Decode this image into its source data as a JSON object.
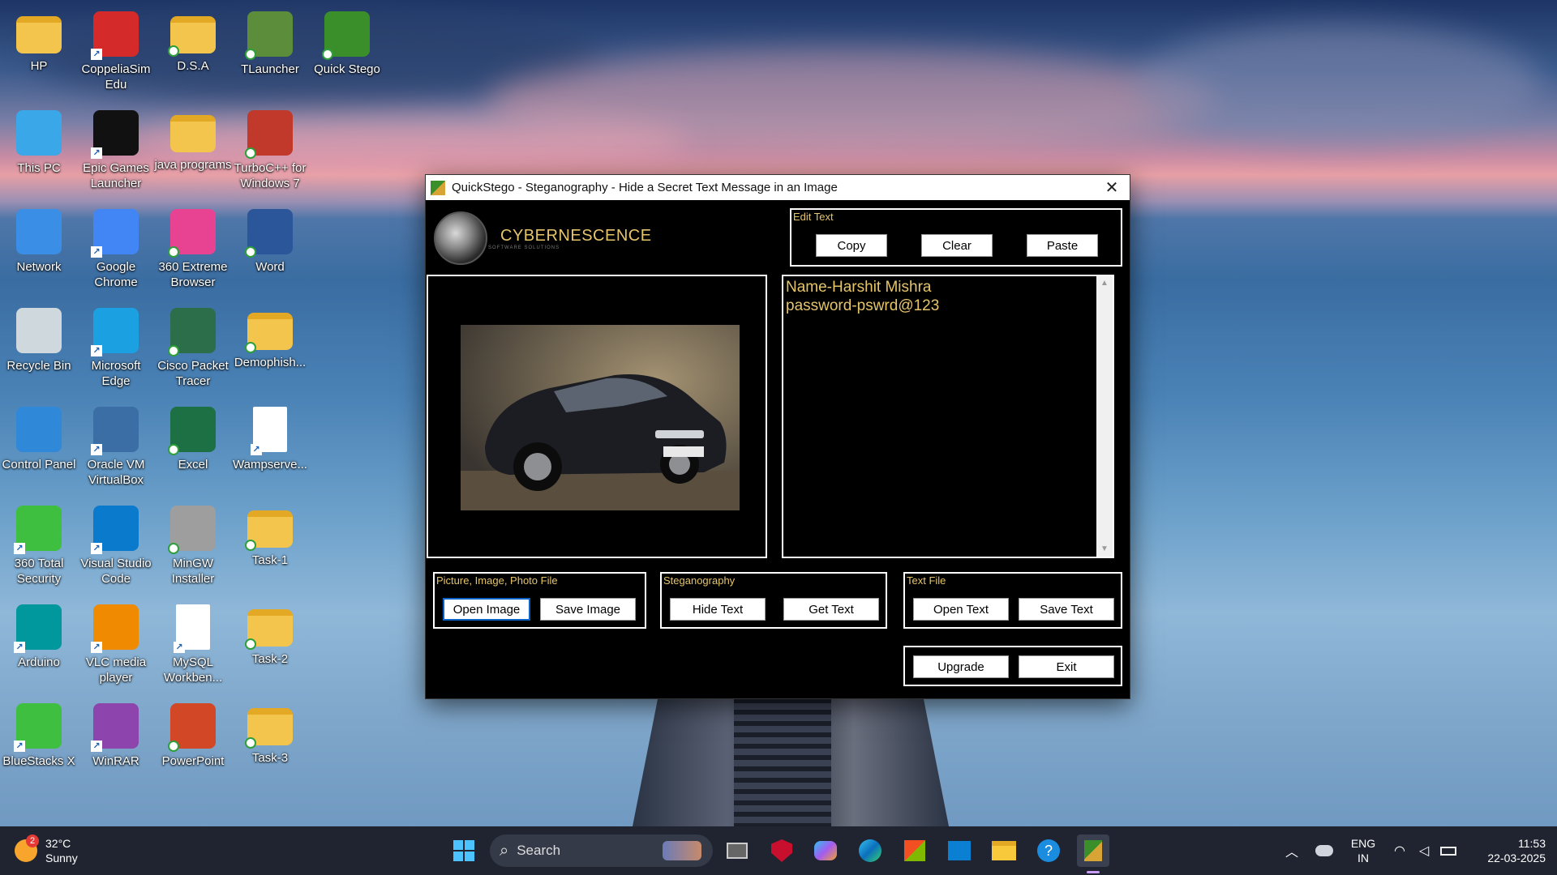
{
  "desktop": {
    "icons": [
      {
        "label": "HP",
        "icon": "folder-user-icon",
        "color": "#f3c54d"
      },
      {
        "label": "CoppeliaSim Edu",
        "icon": "coppeliasim-icon",
        "color": "#d42a2a"
      },
      {
        "label": "D.S.A",
        "icon": "folder-icon",
        "color": "#f3c54d"
      },
      {
        "label": "TLauncher",
        "icon": "minecraft-block-icon",
        "color": "#5b8d3b"
      },
      {
        "label": "Quick Stego",
        "icon": "quickstego-icon",
        "color": "#3b8f2b"
      },
      {
        "label": "This PC",
        "icon": "monitor-icon",
        "color": "#39a7e8"
      },
      {
        "label": "Epic Games Launcher",
        "icon": "epic-games-icon",
        "color": "#111111"
      },
      {
        "label": "java programs",
        "icon": "folder-icon",
        "color": "#f3c54d"
      },
      {
        "label": "TurboC++ for Windows 7",
        "icon": "turboc-icon",
        "color": "#c0392b"
      },
      {
        "label": "Network",
        "icon": "network-icon",
        "color": "#3a8ee6"
      },
      {
        "label": "Google Chrome",
        "icon": "chrome-icon",
        "color": "#4285f4"
      },
      {
        "label": "360 Extreme Browser",
        "icon": "360-browser-icon",
        "color": "#e84393"
      },
      {
        "label": "Word",
        "icon": "word-icon",
        "color": "#2b579a"
      },
      {
        "label": "Recycle Bin",
        "icon": "recycle-bin-icon",
        "color": "#cfd8dc"
      },
      {
        "label": "Microsoft Edge",
        "icon": "edge-icon",
        "color": "#1ba1e2"
      },
      {
        "label": "Cisco Packet Tracer",
        "icon": "cisco-packet-tracer-icon",
        "color": "#2c6e49"
      },
      {
        "label": "Demophish...",
        "icon": "folder-icon",
        "color": "#f3c54d"
      },
      {
        "label": "Control Panel",
        "icon": "control-panel-icon",
        "color": "#2f88d8"
      },
      {
        "label": "Oracle VM VirtualBox",
        "icon": "virtualbox-icon",
        "color": "#3a6ea5"
      },
      {
        "label": "Excel",
        "icon": "excel-icon",
        "color": "#1d7044"
      },
      {
        "label": "Wampserve...",
        "icon": "file-icon",
        "color": "#ffffff"
      },
      {
        "label": "360 Total Security",
        "icon": "360-security-icon",
        "color": "#3fbf3f"
      },
      {
        "label": "Visual Studio Code",
        "icon": "vscode-icon",
        "color": "#0a7acc"
      },
      {
        "label": "MinGW Installer",
        "icon": "mingw-icon",
        "color": "#9e9e9e"
      },
      {
        "label": "Task-1",
        "icon": "folder-icon",
        "color": "#f3c54d"
      },
      {
        "label": "Arduino",
        "icon": "arduino-icon",
        "color": "#00979d"
      },
      {
        "label": "VLC media player",
        "icon": "vlc-icon",
        "color": "#f08a00"
      },
      {
        "label": "MySQL Workben...",
        "icon": "file-icon",
        "color": "#ffffff"
      },
      {
        "label": "Task-2",
        "icon": "folder-icon",
        "color": "#f3c54d"
      },
      {
        "label": "BlueStacks X",
        "icon": "bluestacks-icon",
        "color": "#3fbf3f"
      },
      {
        "label": "WinRAR",
        "icon": "winrar-icon",
        "color": "#8e44ad"
      },
      {
        "label": "PowerPoint",
        "icon": "powerpoint-icon",
        "color": "#d24726"
      },
      {
        "label": "Task-3",
        "icon": "folder-icon",
        "color": "#f3c54d"
      }
    ]
  },
  "window": {
    "title": "QuickStego - Steganography - Hide a Secret Text Message in an Image",
    "close_glyph": "✕",
    "brand": "CYBERNESCENCE",
    "brand_sub": "SOFTWARE SOLUTIONS",
    "edit_text": {
      "title": "Edit Text",
      "copy": "Copy",
      "clear": "Clear",
      "paste": "Paste"
    },
    "secret_text": "Name-Harshit Mishra\npassword-pswrd@123",
    "picture_group": {
      "title": "Picture, Image, Photo File",
      "open": "Open Image",
      "save": "Save Image"
    },
    "stego_group": {
      "title": "Steganography",
      "hide": "Hide Text",
      "get": "Get Text"
    },
    "text_group": {
      "title": "Text File",
      "open": "Open Text",
      "save": "Save Text"
    },
    "upgrade": "Upgrade",
    "exit": "Exit",
    "accent_color": "#e6c56a"
  },
  "taskbar": {
    "weather": {
      "badge": "2",
      "temp": "32°C",
      "condition": "Sunny"
    },
    "search_label": "Search",
    "apps": [
      "start-icon",
      "task-view-icon",
      "mcafee-icon",
      "copilot-icon",
      "edge-icon",
      "store-icon",
      "myhp-icon",
      "file-explorer-icon",
      "help-icon",
      "quickstego-icon"
    ],
    "lang_line1": "ENG",
    "lang_line2": "IN",
    "time": "11:53",
    "date": "22-03-2025"
  }
}
